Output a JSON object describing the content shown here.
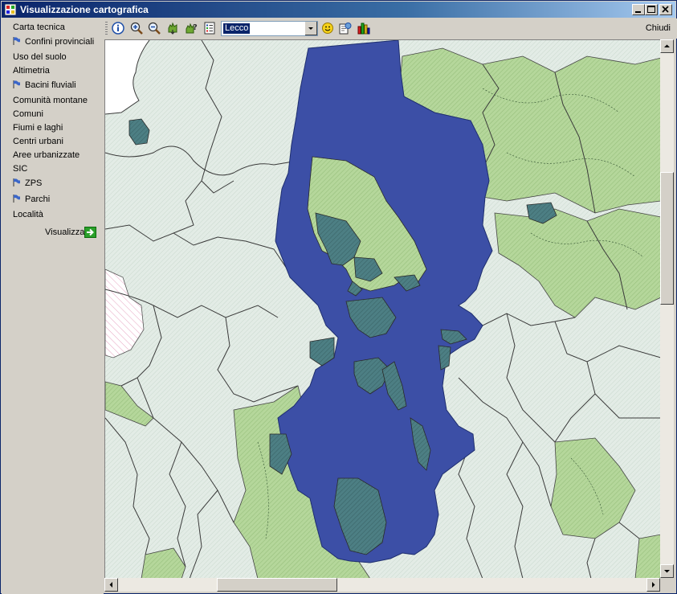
{
  "window": {
    "title": "Visualizzazione cartografica"
  },
  "sidebar": {
    "items": [
      {
        "label": "Carta tecnica",
        "flag": false
      },
      {
        "label": "Confini provinciali",
        "flag": true
      },
      {
        "label": "Uso del suolo",
        "flag": false
      },
      {
        "label": "Altimetria",
        "flag": false
      },
      {
        "label": "Bacini fluviali",
        "flag": true
      },
      {
        "label": "Comunità montane",
        "flag": false
      },
      {
        "label": "Comuni",
        "flag": false
      },
      {
        "label": "Fiumi e laghi",
        "flag": false
      },
      {
        "label": "Centri urbani",
        "flag": false
      },
      {
        "label": "Aree urbanizzate",
        "flag": false
      },
      {
        "label": "SIC",
        "flag": false
      },
      {
        "label": "ZPS",
        "flag": true
      },
      {
        "label": "Parchi",
        "flag": true
      },
      {
        "label": "Località",
        "flag": false
      }
    ],
    "visualizza_label": "Visualizza"
  },
  "toolbar": {
    "icons": [
      "info-icon",
      "zoom-in-icon",
      "zoom-out-icon",
      "pan-icon",
      "identify-icon",
      "legend-icon"
    ],
    "province_value": "Lecco",
    "extra_icons": [
      "smiley-icon",
      "export-icon",
      "chart-icon"
    ],
    "close_label": "Chiudi"
  },
  "colors": {
    "lake": "#3c4fa6",
    "park": "#b5d79b",
    "base": "#e3ece6",
    "zps": "#4d7f84",
    "border": "#3a3a3a"
  }
}
